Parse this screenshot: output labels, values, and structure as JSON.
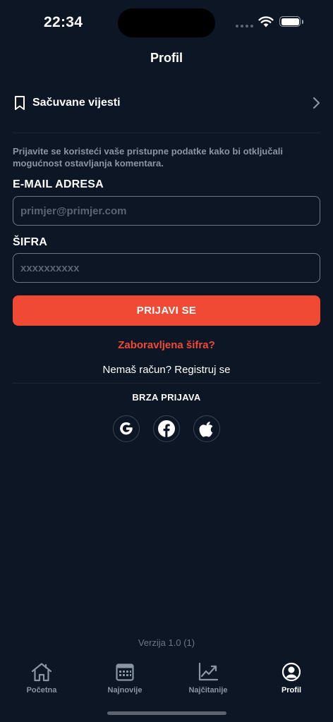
{
  "status_bar": {
    "time": "22:34"
  },
  "header": {
    "title": "Profil"
  },
  "saved_news": {
    "label": "Sačuvane vijesti"
  },
  "login": {
    "info_text": "Prijavite se koristeći vaše pristupne podatke kako bi otključali mogućnost ostavljanja komentara.",
    "email_label": "E-MAIL ADRESA",
    "email_placeholder": "primjer@primjer.com",
    "email_value": "",
    "password_label": "ŠIFRA",
    "password_placeholder": "xxxxxxxxxx",
    "password_value": "",
    "submit_label": "PRIJAVI SE",
    "forgot_label": "Zaboravljena šifra?",
    "register_label": "Nemaš račun? Registruj se"
  },
  "quick_login": {
    "title": "BRZA PRIJAVA",
    "providers": [
      "google-icon",
      "facebook-icon",
      "apple-icon"
    ]
  },
  "version": "Verzija 1.0 (1)",
  "tab_bar": {
    "items": [
      {
        "label": "Početna",
        "icon": "home-icon",
        "active": false
      },
      {
        "label": "Najnovije",
        "icon": "calendar-icon",
        "active": false
      },
      {
        "label": "Najčitanije",
        "icon": "trending-chart-icon",
        "active": false
      },
      {
        "label": "Profil",
        "icon": "user-circle-icon",
        "active": true
      }
    ]
  },
  "colors": {
    "background": "#0c1624",
    "accent": "#f04a35",
    "muted_text": "#8a95a3",
    "input_border": "#6e7884"
  }
}
